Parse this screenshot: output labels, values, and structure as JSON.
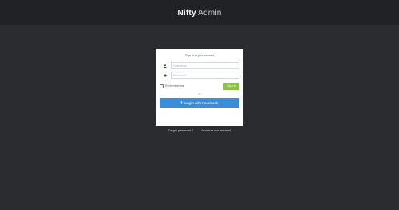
{
  "header": {
    "brand_bold": "Nifty",
    "brand_light": "Admin"
  },
  "login": {
    "title": "Sign In to your account",
    "username_placeholder": "Username",
    "password_placeholder": "Password",
    "remember_label": "Remember me",
    "signin_label": "Sign In",
    "or_label": "- or -",
    "facebook_icon_char": "f",
    "facebook_label": "Login with Facebook"
  },
  "footer_links": {
    "forgot": "Forgot password ?",
    "create": "Create a new account"
  },
  "colors": {
    "background": "#2b2c30",
    "topbar": "#212226",
    "signin_button": "#8bc34a",
    "facebook_button": "#3b8dd8"
  },
  "icons": {
    "username": "user-icon",
    "password": "asterisk-icon",
    "facebook": "facebook-icon"
  }
}
